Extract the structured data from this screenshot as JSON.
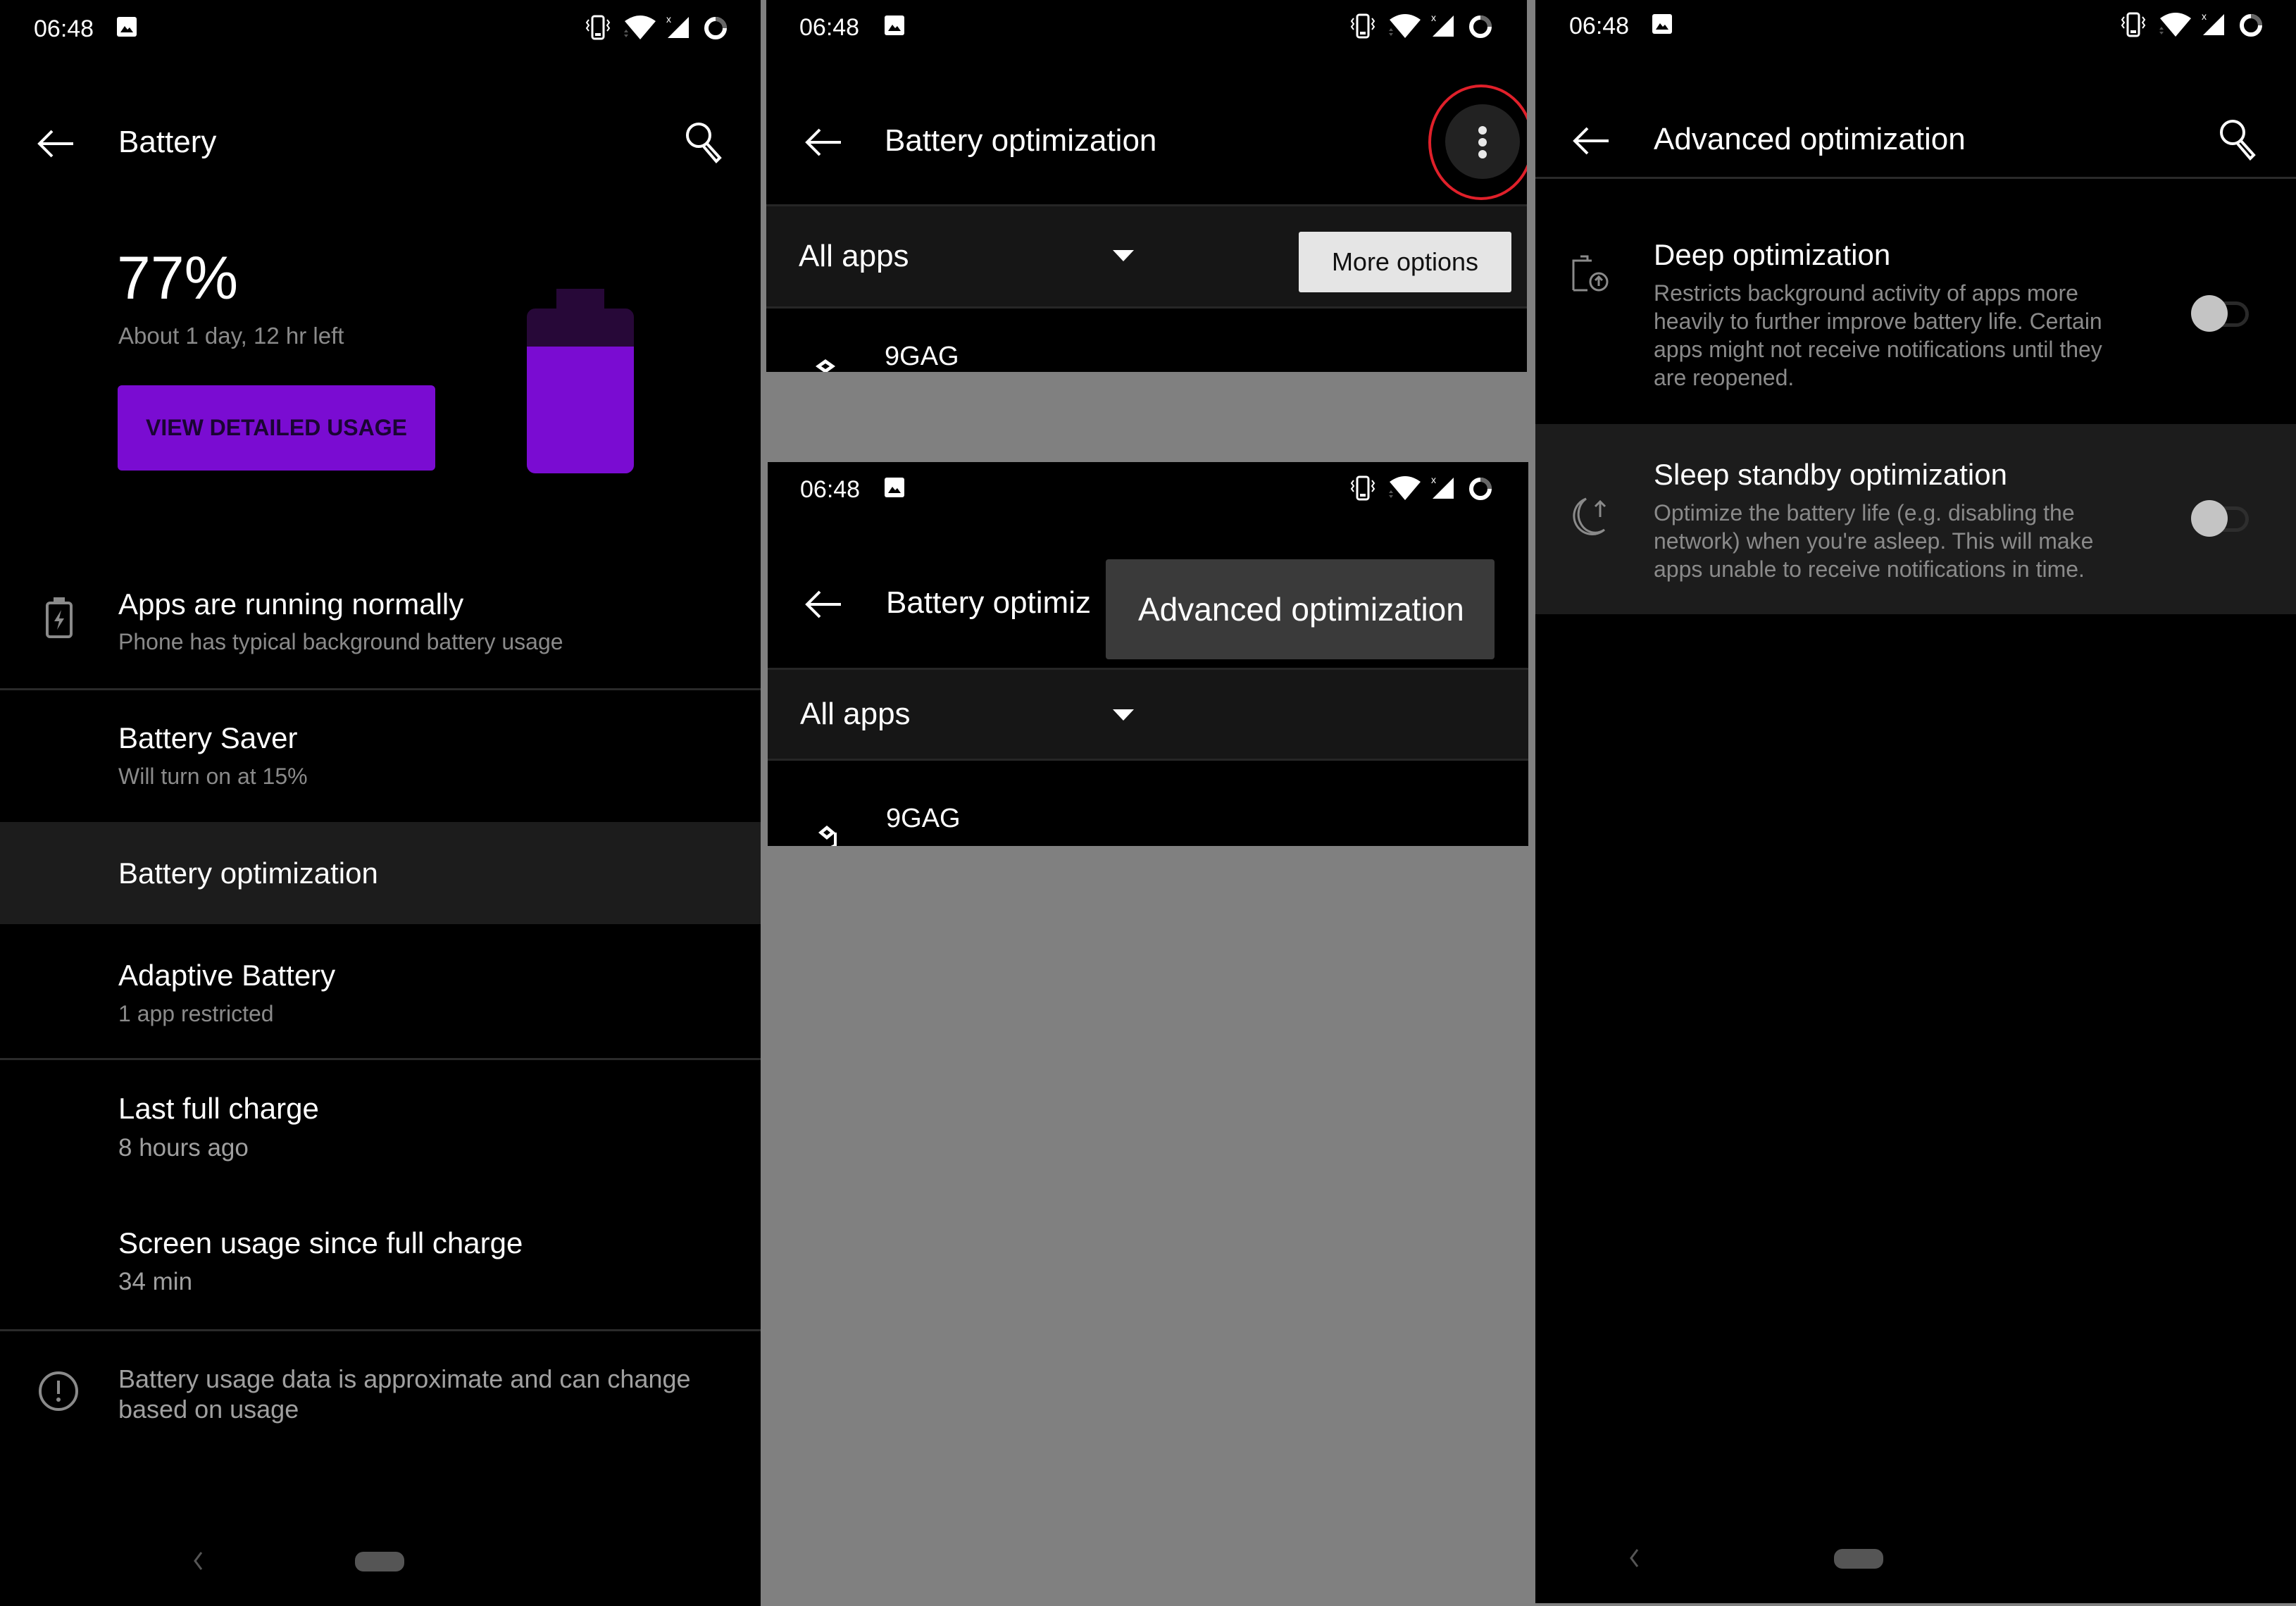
{
  "status_bar": {
    "time": "06:48",
    "icons": [
      "image-notification-icon",
      "vibrate-icon",
      "wifi-icon",
      "signal-no-data-icon",
      "battery-ring-icon"
    ]
  },
  "battery_screen": {
    "title": "Battery",
    "percent": "77%",
    "level_fraction": 0.77,
    "time_left": "About 1 day, 12 hr left",
    "detail_button": "VIEW DETAILED USAGE",
    "accent_color": "#7a0cd2",
    "items": [
      {
        "title": "Apps are running normally",
        "subtitle": "Phone has typical background battery usage",
        "icon": "battery-charging-icon"
      },
      {
        "title": "Battery Saver",
        "subtitle": "Will turn on at 15%"
      },
      {
        "title": "Battery optimization",
        "subtitle": ""
      },
      {
        "title": "Adaptive Battery",
        "subtitle": "1 app restricted"
      },
      {
        "title": "Last full charge",
        "subtitle": "8 hours ago"
      },
      {
        "title": "Screen usage since full charge",
        "subtitle": "34 min"
      }
    ],
    "footer_info_line1": "Battery usage data is approximate and can change",
    "footer_info_line2": "based on usage"
  },
  "optimization_screen": {
    "title": "Battery optimization",
    "title_truncated": "Battery optimiz",
    "filter_value": "All apps",
    "more_options_label": "More options",
    "overflow_menu_item": "Advanced optimization",
    "apps": [
      {
        "name": "9GAG"
      }
    ],
    "annotation_color": "#e0202a"
  },
  "advanced_screen": {
    "title": "Advanced optimization",
    "settings": [
      {
        "title": "Deep optimization",
        "desc_lines": [
          "Restricts background activity of apps more",
          "heavily to further improve battery life. Certain",
          "apps might not receive notifications until they",
          "are reopened."
        ],
        "enabled": false
      },
      {
        "title": "Sleep standby optimization",
        "desc_lines": [
          "Optimize the battery life (e.g. disabling the",
          "network) when you're asleep. This will make",
          "apps unable to receive notifications in time."
        ],
        "enabled": false
      }
    ]
  }
}
